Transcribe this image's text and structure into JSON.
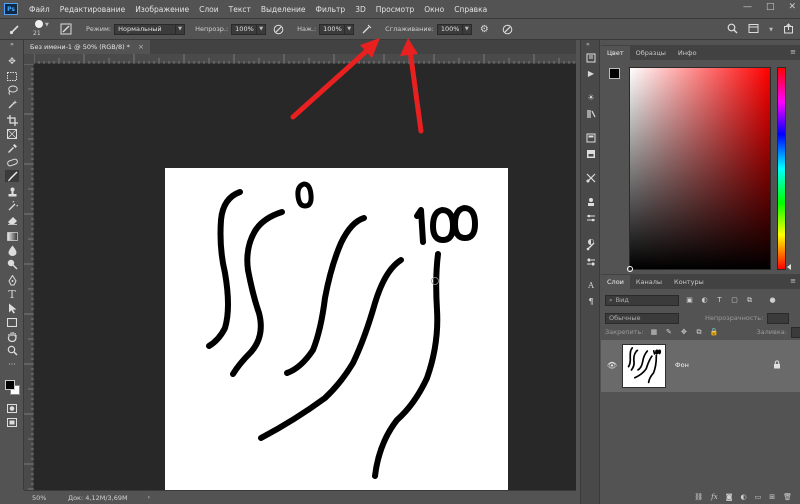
{
  "app": {
    "logo": "Ps"
  },
  "menu": [
    "Файл",
    "Редактирование",
    "Изображение",
    "Слои",
    "Текст",
    "Выделение",
    "Фильтр",
    "3D",
    "Просмотр",
    "Окно",
    "Справка"
  ],
  "window_controls": {
    "minimize": "—",
    "maximize": "□",
    "close": "✕"
  },
  "options": {
    "brush_size": "21",
    "mode_label": "Режим:",
    "mode_value": "Нормальный",
    "opacity_label": "Непрозр.:",
    "opacity_value": "100%",
    "flow_label": "Наж.:",
    "flow_value": "100%",
    "smoothing_label": "Сглаживание:",
    "smoothing_value": "100%"
  },
  "document": {
    "tab_title": "Без имени-1 @ 50% (RGB/8) *",
    "close": "×"
  },
  "status": {
    "zoom": "50%",
    "doc_info": "Док: 4,12M/3,69M",
    "arrow": "›"
  },
  "annotations": {
    "label_zero": "0",
    "label_hundred": "100",
    "arrow_color": "#e82020"
  },
  "color_panel": {
    "tabs": [
      "Цвет",
      "Образцы",
      "Инфо"
    ],
    "menu_glyph": "≡",
    "foreground": "#000000",
    "background": "#ffffff",
    "hue": "#ff0000"
  },
  "layers_panel": {
    "tabs": [
      "Слои",
      "Каналы",
      "Контуры"
    ],
    "menu_glyph": "≡",
    "filter_placeholder": "Вид",
    "blend_mode": "Обычные",
    "opacity_label": "Непрозрачность:",
    "lock_label": "Закрепить:",
    "fill_label": "Заливка:",
    "layer_name": "Фон"
  }
}
